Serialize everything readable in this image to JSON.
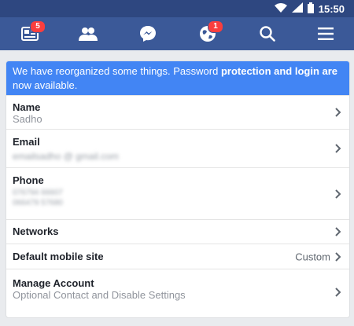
{
  "status_bar": {
    "time": "15:50"
  },
  "nav": {
    "feed_badge": "5",
    "notifications_badge": "1"
  },
  "notice": {
    "text_start": "We have reorganized some things. Password ",
    "text_bold": "protection and login are",
    "text_end": " now available."
  },
  "rows": {
    "name": {
      "title": "Name",
      "value": "Sadho"
    },
    "email": {
      "title": "Email",
      "value": "emailsadho @ gmail.com"
    },
    "phone": {
      "title": "Phone",
      "value1": "076794 66607",
      "value2": "066479 57680"
    },
    "networks": {
      "title": "Networks"
    },
    "default_site": {
      "title": "Default mobile site",
      "value": "Custom"
    },
    "manage": {
      "title": "Manage Account",
      "value": "Optional Contact and Disable Settings"
    }
  },
  "colors": {
    "status_bar": "#2e4780",
    "nav_bar": "#3b5998",
    "notice_bg": "#4285f4",
    "badge": "#fa3e3e"
  }
}
